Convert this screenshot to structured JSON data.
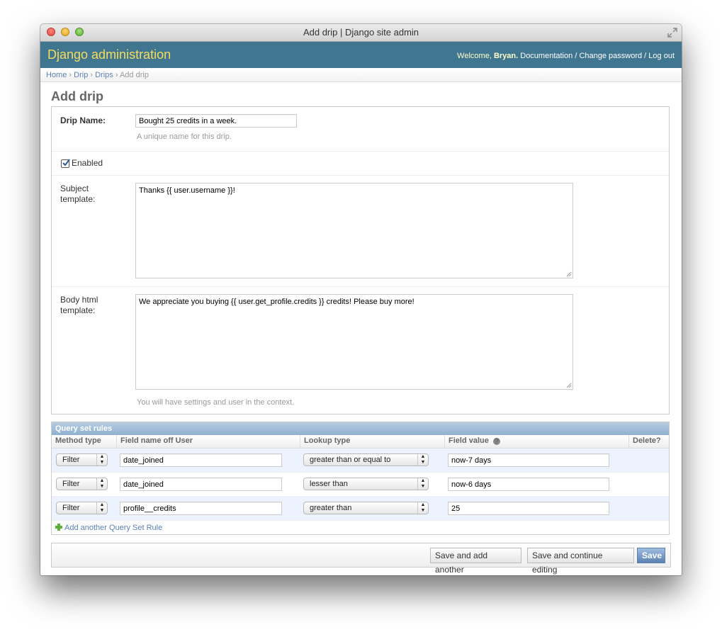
{
  "window": {
    "title": "Add drip | Django site admin"
  },
  "header": {
    "site_name": "Django administration",
    "welcome": "Welcome,",
    "username": "Bryan.",
    "documentation": "Documentation",
    "sep": "/",
    "change_password": "Change password",
    "log_out": "Log out"
  },
  "breadcrumbs": {
    "home": "Home",
    "app": "Drip",
    "model": "Drips",
    "current": "Add drip",
    "sep": "›"
  },
  "page_title": "Add drip",
  "form": {
    "name_label": "Drip Name:",
    "name_value": "Bought 25 credits in a week.",
    "name_help": "A unique name for this drip.",
    "enabled_label": "Enabled",
    "enabled_checked": true,
    "subject_label_1": "Subject",
    "subject_label_2": "template:",
    "subject_value": "Thanks {{ user.username }}!",
    "body_label_1": "Body html",
    "body_label_2": "template:",
    "body_value": "We appreciate you buying {{ user.get_profile.credits }} credits! Please buy more!",
    "body_help": "You will have settings and user in the context."
  },
  "inline": {
    "title": "Query set rules",
    "columns": [
      "Method type",
      "Field name off User",
      "Lookup type",
      "Field value",
      "Delete?"
    ],
    "rows": [
      {
        "method": "Filter",
        "field": "date_joined",
        "lookup": "greater than or equal to",
        "value": "now-7 days"
      },
      {
        "method": "Filter",
        "field": "date_joined",
        "lookup": "lesser than",
        "value": "now-6 days"
      },
      {
        "method": "Filter",
        "field": "profile__credits",
        "lookup": "greater than",
        "value": "25"
      }
    ],
    "add_label": "Add another Query Set Rule"
  },
  "submit": {
    "save_add": "Save and add another",
    "save_continue": "Save and continue editing",
    "save": "Save"
  },
  "colors": {
    "header_bg": "#417690",
    "site_name": "#f5dd5d",
    "link": "#5b80b2"
  }
}
